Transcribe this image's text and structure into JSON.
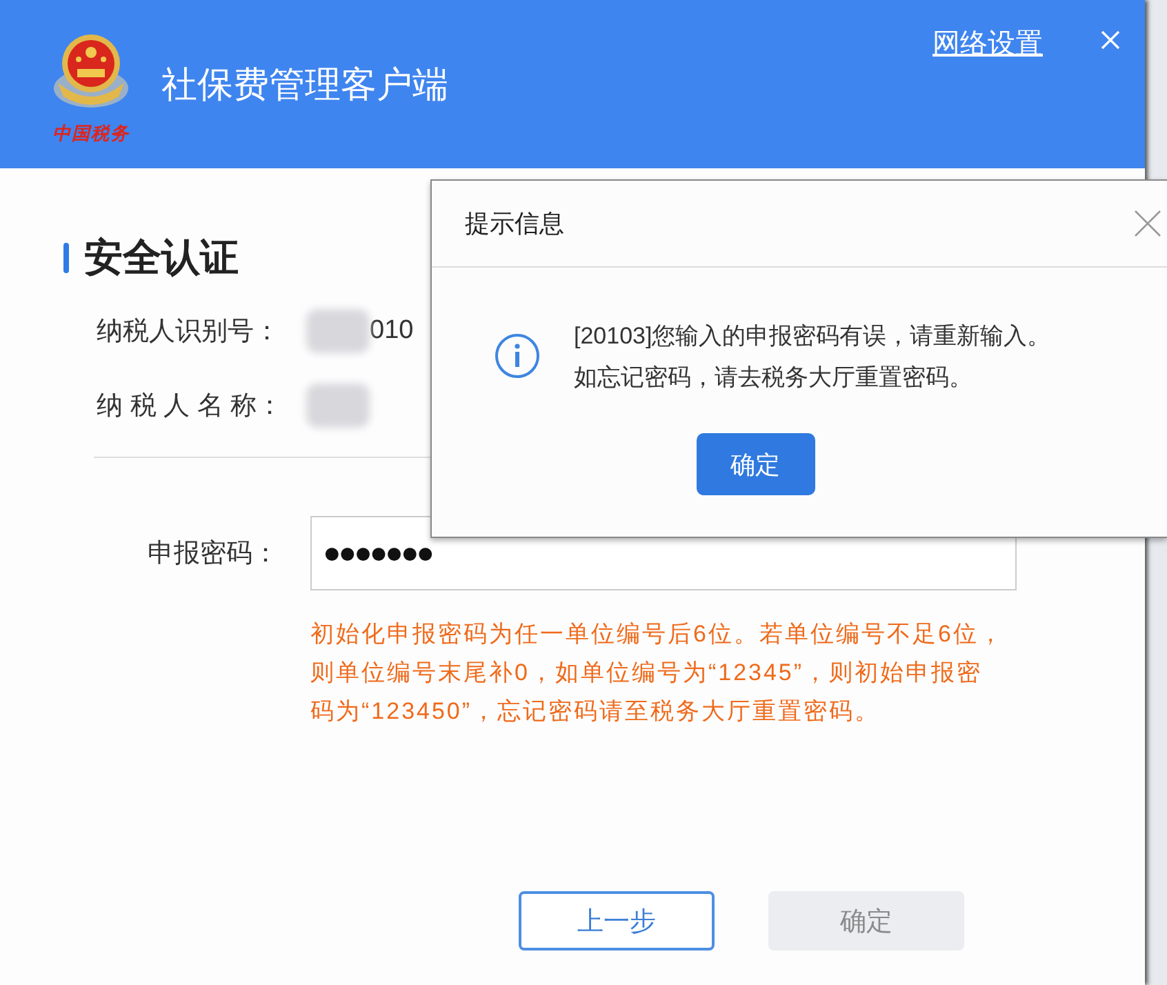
{
  "window": {
    "title": "社保费管理客户端",
    "logo_caption": "中国税务",
    "network_settings_link": "网络设置"
  },
  "section": {
    "title": "安全认证",
    "fields": [
      {
        "label": "纳税人识别号：",
        "value": "010",
        "redacted": true
      },
      {
        "label": "纳 税 人 名 称：",
        "redacted": true
      }
    ]
  },
  "password": {
    "label": "申报密码：",
    "value": "●●●●●●●"
  },
  "hint": "初始化申报密码为任一单位编号后6位。若单位编号不足6位，则单位编号末尾补0，如单位编号为“12345”，则初始申报密码为“123450”，忘记密码请至税务大厅重置密码。",
  "buttons": [
    {
      "label": "上一步",
      "kind": "secondary",
      "disabled": false
    },
    {
      "label": "确定",
      "kind": "primary",
      "disabled": true
    }
  ],
  "dialog": {
    "title": "提示信息",
    "message_lines": [
      "[20103]您输入的申报密码有误，请重新输入。",
      "如忘记密码，请去税务大厅重置密码。"
    ],
    "button": "确定"
  }
}
